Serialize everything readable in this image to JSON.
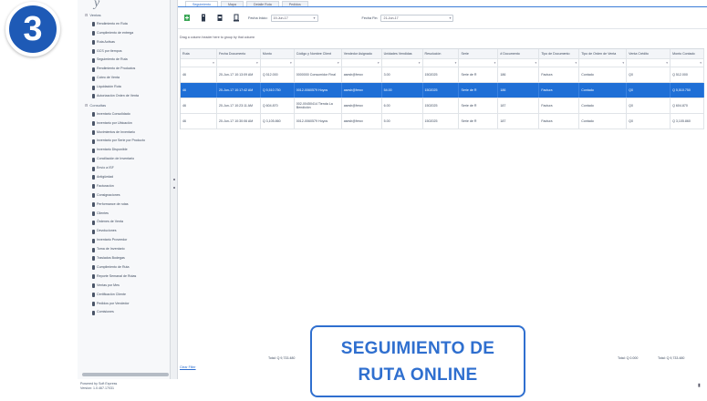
{
  "app": {
    "logo": "y",
    "footer_line1": "Powered by Soft Express",
    "footer_line2": "Version: 1.0.467.17031"
  },
  "sidebar": {
    "groups": [
      {
        "label": "Ventas",
        "items": [
          "Rendimiento en Ruta",
          "Cumplimiento de entrega",
          "Ruta Activas",
          "GCS por tiempos",
          "Seguimiento de Ruta",
          "Rendimiento de Productos",
          "Cobro de Venta",
          "Liquidación Ruta",
          "Autorización Orden de Venta"
        ]
      },
      {
        "label": "Consultas",
        "items": [
          "Inventario Consolidado",
          "Inventario por Ubicación",
          "Movimientos de Inventario",
          "Inventario por Serie por Producto",
          "Inventario Disponible",
          "Conciliación de Inventario",
          "Envío a ISF",
          "Antigüedad",
          "Facturación",
          "Consignaciones",
          "Performance de rutas",
          "Clientes",
          "Órdenes de Venta",
          "Devoluciones",
          "Inventario Proveedor",
          "Toma de Inventario",
          "Traslados Bodegas",
          "Cumplimiento de Ruta",
          "Reporte Semanal de Rutas",
          "Ventas por Mes",
          "Certificación Cliente",
          "Pedidos por Vendedor",
          "Comisiones"
        ]
      }
    ]
  },
  "tabs": [
    "Seguimiento",
    "Mapa",
    "Detalle Ruta",
    "Pedidos"
  ],
  "toolbar": {
    "fecha_inicio_label": "Fecha Inicio:",
    "fecha_inicio_value": "19-Jun-17",
    "fecha_fin_label": "Fecha Fin:",
    "fecha_fin_value": "21-Jun-17"
  },
  "group_hint": "Drag a column header here to group by that column",
  "grid": {
    "columns": [
      "Ruta",
      "Fecha Documento",
      "Monto",
      "Código y Nombre Client",
      "Vendedor Asignado",
      "Unidades Vendidas",
      "Resolución",
      "Serie",
      "# Documento",
      "Tipo de Documento",
      "Tipo de Orden de Venta",
      "Venta Crédito",
      "Monto Contado"
    ],
    "rows": [
      [
        "46",
        "20-Jun-17 10:13:09 AM",
        "Q 512.000",
        "0000000 Consumidor Final",
        "asesh@ferox",
        "3.00",
        "1502025",
        "Serie de R",
        "186",
        "Factura",
        "Contado",
        "Q0",
        "Q 512.000"
      ],
      [
        "46",
        "20-Jun-17 10:17:42 AM",
        "Q 5,510.750",
        "0012-0060579 Hoyos",
        "asesh@ferox",
        "54.00",
        "1502025",
        "Serie de R",
        "186",
        "Factura",
        "Contado",
        "Q0",
        "Q 5,510.750"
      ],
      [
        "46",
        "20-Jun-17 10:23:11 AM",
        "Q 604.870",
        "002-00450414 Tienda La Bendición",
        "asesh@ferox",
        "6.00",
        "1502025",
        "Serie de R",
        "187",
        "Factura",
        "Contado",
        "Q0",
        "Q 604.870"
      ],
      [
        "46",
        "20-Jun-17 10:30:06 AM",
        "Q 3,105.860",
        "0012-0060579 Hoyos",
        "asesh@ferox",
        "5.00",
        "1502025",
        "Serie de R",
        "187",
        "Factura",
        "Contado",
        "Q0",
        "Q 3,105.860"
      ]
    ],
    "selected_row": 1,
    "total_monto": "Total: Q 9,733.480",
    "total_credito": "Total: Q 0.000",
    "total_contado": "Total: Q 9,733.480",
    "clear_filter": "Clear Filter"
  },
  "badge_number": "3",
  "caption": {
    "line1": "SEGUIMIENTO DE",
    "line2": "RUTA ONLINE"
  },
  "colors": {
    "accent": "#2f6fcf",
    "badge": "#1e5ab6",
    "selected_row": "#1f6fd6"
  }
}
